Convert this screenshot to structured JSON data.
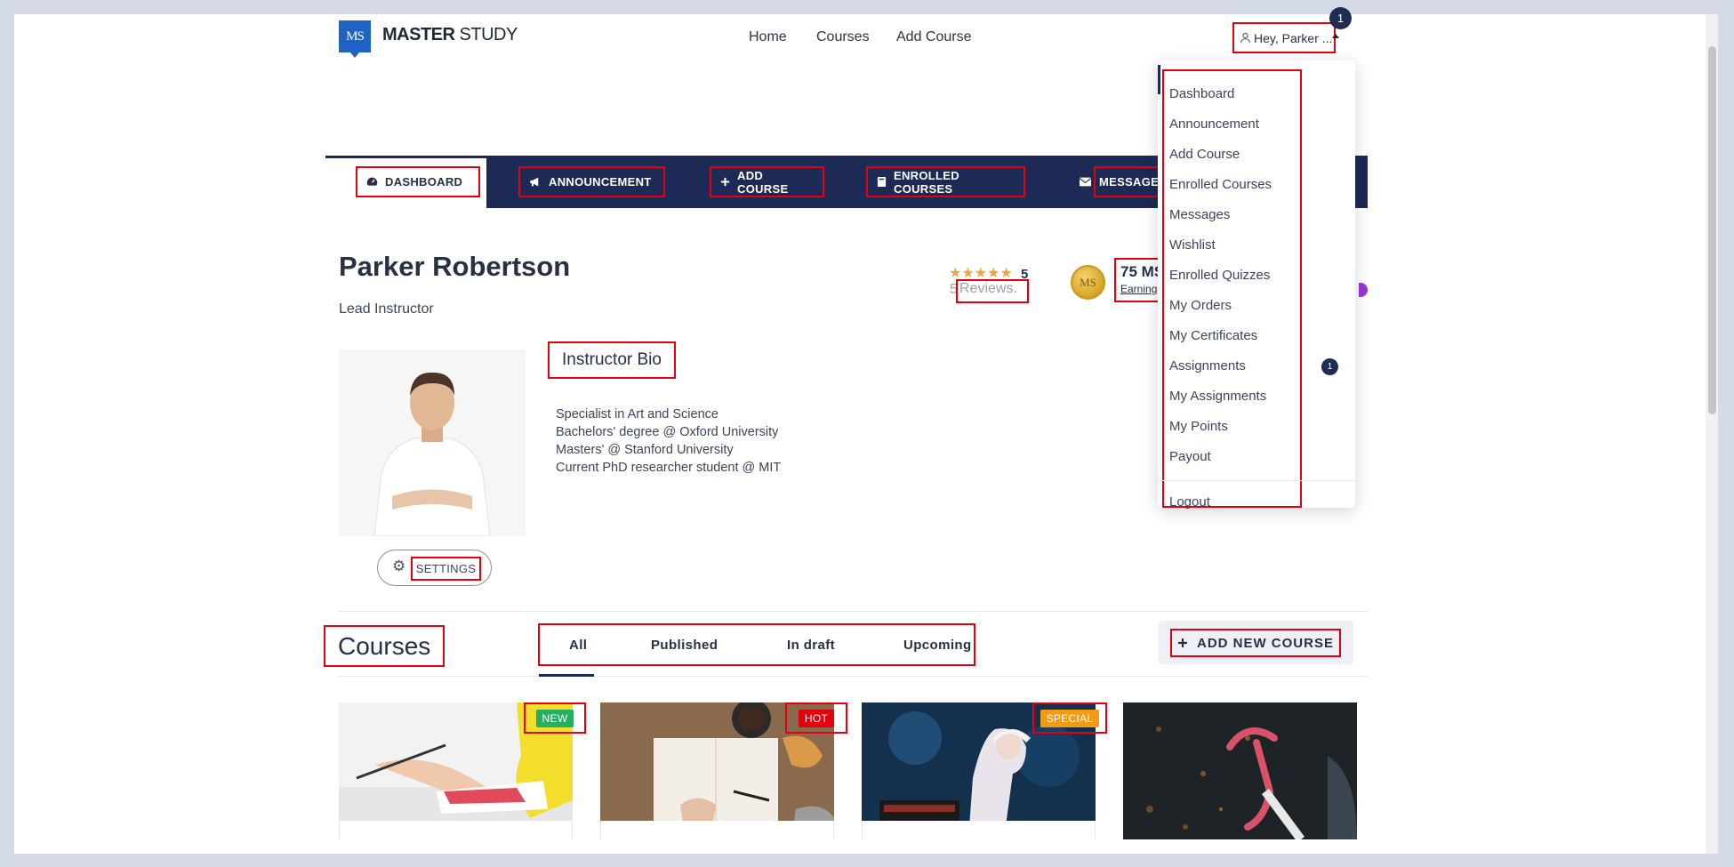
{
  "header": {
    "logo_mark": "MS",
    "logo_bold": "MASTER",
    "logo_light": "STUDY",
    "nav": [
      "Home",
      "Courses",
      "Add Course"
    ],
    "user_greeting": "Hey, Parker ...",
    "notification_count": "1"
  },
  "tabs": [
    {
      "label": "DASHBOARD",
      "icon": "gauge-icon"
    },
    {
      "label": "ANNOUNCEMENT",
      "icon": "megaphone-icon"
    },
    {
      "label": "ADD COURSE",
      "icon": "plus-icon"
    },
    {
      "label": "ENROLLED COURSES",
      "icon": "book-icon"
    },
    {
      "label": "MESSAGES",
      "icon": "envelope-icon"
    }
  ],
  "profile": {
    "name": "Parker Robertson",
    "role": "Lead Instructor",
    "stars": "★★★★★",
    "rating": "5",
    "reviews_count": "5",
    "reviews_label": "Reviews.",
    "points": "75 MS",
    "earning_label": "Earning",
    "settings_label": "SETTINGS",
    "bio_title": "Instructor Bio",
    "bio_lines": [
      "Specialist in Art and Science",
      "Bachelors' degree @ Oxford University",
      "Masters' @ Stanford University",
      "Current PhD researcher student @ MIT"
    ]
  },
  "courses": {
    "title": "Courses",
    "filters": [
      "All",
      "Published",
      "In draft",
      "Upcoming"
    ],
    "active_filter": "All",
    "add_new_label": "ADD NEW COURSE",
    "cards": [
      {
        "badge": "NEW",
        "badge_color": "#27ae60"
      },
      {
        "badge": "HOT",
        "badge_color": "#e3000f"
      },
      {
        "badge": "SPECIAL",
        "badge_color": "#f39c12"
      },
      {
        "badge": "",
        "badge_color": ""
      }
    ]
  },
  "dropdown": {
    "items": [
      "Dashboard",
      "Announcement",
      "Add Course",
      "Enrolled Courses",
      "Messages",
      "Wishlist",
      "Enrolled Quizzes",
      "My Orders",
      "My Certificates",
      "Assignments",
      "My Assignments",
      "My Points",
      "Payout"
    ],
    "assignments_badge": "1",
    "logout": "Logout"
  },
  "colors": {
    "navy": "#1d2a56",
    "highlight": "#e3000f",
    "brand_blue": "#1e63c4"
  }
}
